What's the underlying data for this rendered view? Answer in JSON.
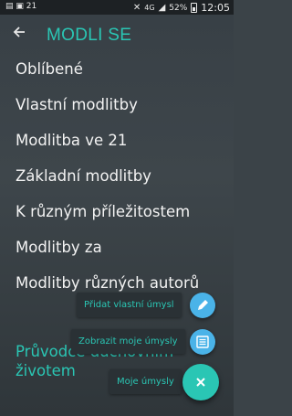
{
  "status_bar": {
    "notification_count": "21",
    "network": "4G",
    "battery": "52%",
    "time": "12:05"
  },
  "app_bar": {
    "title": "MODLI SE",
    "back_icon": "arrow-left-icon"
  },
  "menu": {
    "items": [
      {
        "label": "Oblíbené"
      },
      {
        "label": "Vlastní modlitby"
      },
      {
        "label": "Modlitba ve 21"
      },
      {
        "label": "Základní modlitby"
      },
      {
        "label": "K různým příležitostem"
      },
      {
        "label": "Modlitby za"
      },
      {
        "label": "Modlitby různých autorů"
      }
    ],
    "accent_item": {
      "line1": "Průvodce duchovním",
      "line2": "životem"
    }
  },
  "fab_menu": {
    "add_label": "Přidat vlastní úmysl",
    "add_icon": "pencil-icon",
    "show_label": "Zobrazit moje úmysly",
    "show_icon": "list-icon",
    "main_label": "Moje úmysly",
    "main_icon": "close-icon"
  },
  "colors": {
    "accent": "#2ac6b4",
    "fab_secondary": "#4ab3e8",
    "background": "#3b4348"
  }
}
